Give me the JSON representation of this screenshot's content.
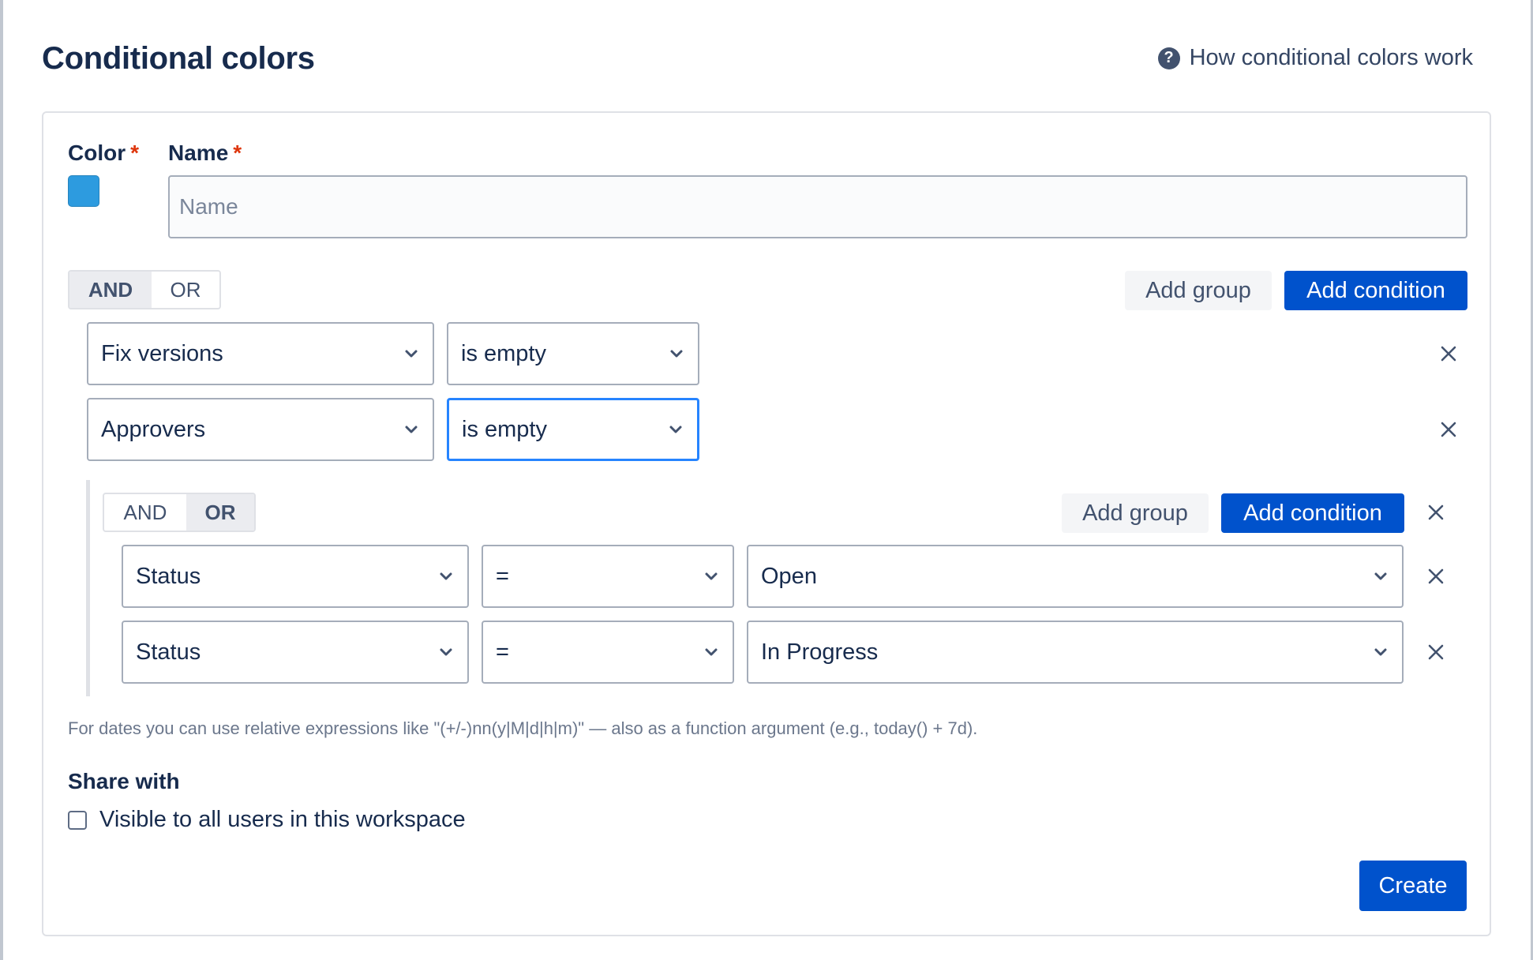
{
  "dialog": {
    "title": "Conditional colors",
    "help_link": "How conditional colors work",
    "help_icon": "question-circle-icon"
  },
  "form": {
    "color_label": "Color",
    "name_label": "Name",
    "required_mark": "*",
    "color_value": "#2d9bdf",
    "name_placeholder": "Name",
    "name_value": ""
  },
  "root_group": {
    "logic": {
      "and": "AND",
      "or": "OR",
      "active": "AND"
    },
    "add_group": "Add group",
    "add_condition": "Add condition",
    "conditions": [
      {
        "field": "Fix versions",
        "operator": "is empty"
      },
      {
        "field": "Approvers",
        "operator": "is empty"
      }
    ]
  },
  "sub_group": {
    "logic": {
      "and": "AND",
      "or": "OR",
      "active": "OR"
    },
    "add_group": "Add group",
    "add_condition": "Add condition",
    "conditions": [
      {
        "field": "Status",
        "operator": "=",
        "value": "Open"
      },
      {
        "field": "Status",
        "operator": "=",
        "value": "In Progress"
      }
    ]
  },
  "hint": "For dates you can use relative expressions like \"(+/-)nn(y|M|d|h|m)\" — also as a function argument (e.g., today() + 7d).",
  "share": {
    "title": "Share with",
    "checkbox_label": "Visible to all users in this workspace",
    "checked": false
  },
  "footer": {
    "create": "Create"
  },
  "colors": {
    "primary": "#0052cc",
    "focus": "#2684ff",
    "required": "#de350b"
  }
}
